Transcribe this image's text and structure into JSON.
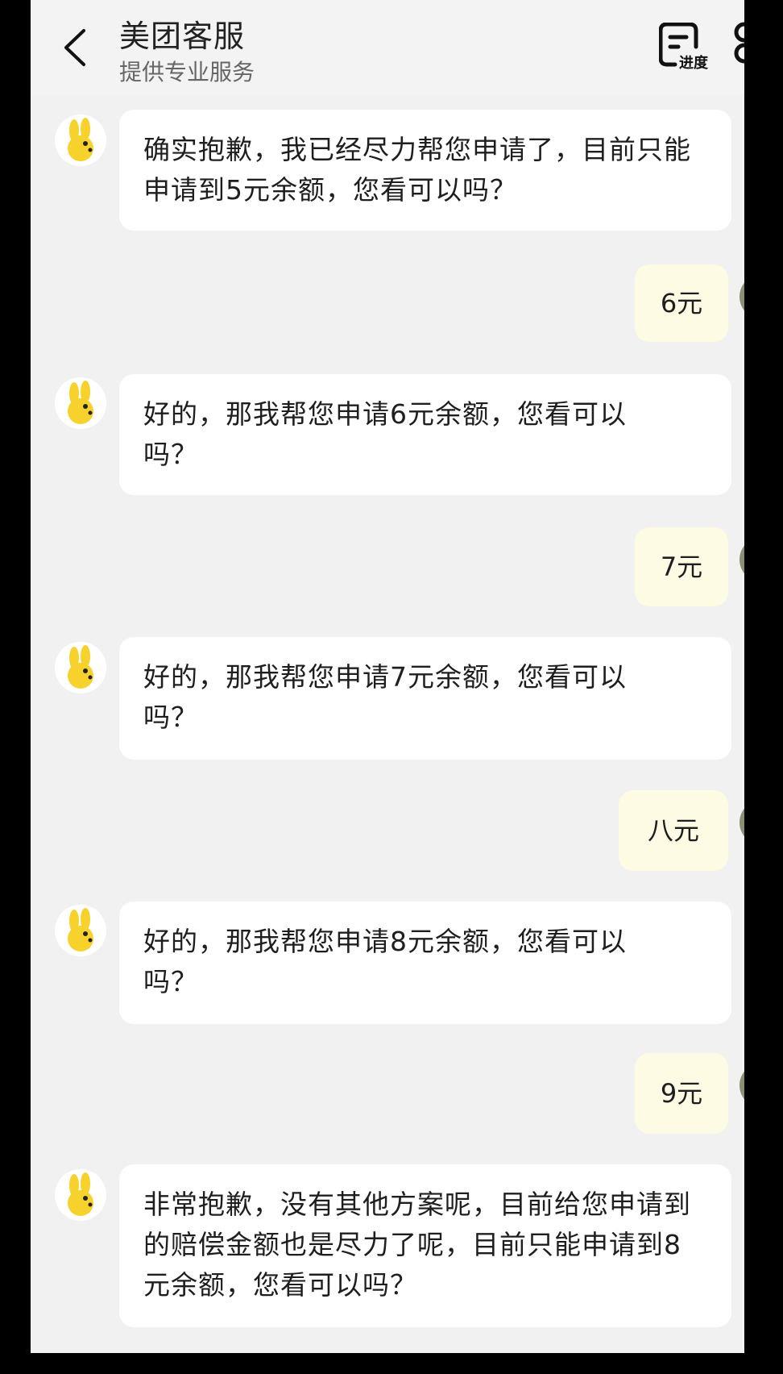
{
  "header": {
    "title": "美团客服",
    "subtitle": "提供专业服务",
    "progress_label": "进度",
    "icons": [
      "chevron-left-icon",
      "progress-icon",
      "more-icon"
    ]
  },
  "messages": [
    {
      "from": "bot",
      "text": "确实抱歉，我已经尽力帮您申请了，目前只能申请到5元余额，您看可以吗？"
    },
    {
      "from": "user",
      "text": "6元"
    },
    {
      "from": "bot",
      "text": "好的，那我帮您申请6元余额，您看可以吗？"
    },
    {
      "from": "user",
      "text": "7元"
    },
    {
      "from": "bot",
      "text": "好的，那我帮您申请7元余额，您看可以吗？"
    },
    {
      "from": "user",
      "text": "八元"
    },
    {
      "from": "bot",
      "text": "好的，那我帮您申请8元余额，您看可以吗？"
    },
    {
      "from": "user",
      "text": "9元"
    },
    {
      "from": "bot",
      "text": "非常抱歉，没有其他方案呢，目前给您申请到的赔偿金额也是尽力了呢，目前只能申请到8元余额，您看可以吗？"
    }
  ],
  "colors": {
    "bot_bubble": "#ffffff",
    "user_bubble": "#fdfbe3",
    "background": "#f1f1f1",
    "mascot": "#f7d12c"
  }
}
